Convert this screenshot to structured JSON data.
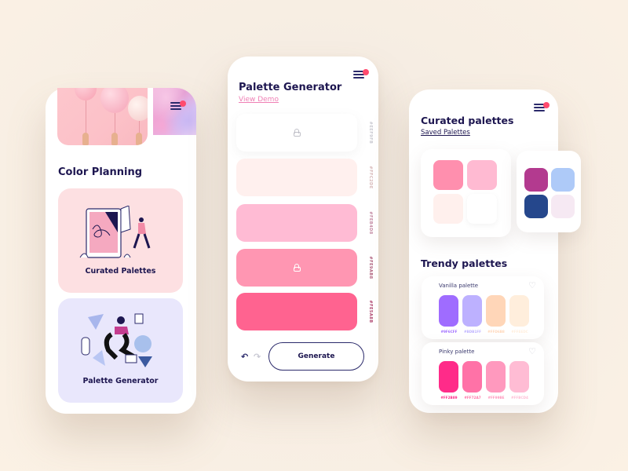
{
  "colors": {
    "navy": "#1d1650",
    "accent_dot": "#ff4b6e",
    "link_pink": "#ef7fb4"
  },
  "left_screen": {
    "title": "Color Planning",
    "hero_images": [
      "balloons-photo",
      "marble-texture"
    ],
    "cards": [
      {
        "label": "Curated Palettes",
        "illustration": "tablet-drawing-person",
        "bg": "#fde0e2"
      },
      {
        "label": "Palette Generator",
        "illustration": "floating-person-shapes",
        "bg": "#e9e7fc"
      }
    ]
  },
  "middle_screen": {
    "title": "Palette Generator",
    "link": "View Demo",
    "swatches": [
      {
        "color": "#ffffff",
        "hex": "#EEF9FB",
        "locked": true
      },
      {
        "color": "#fff0ee",
        "hex": "#FFC2DE",
        "locked": false
      },
      {
        "color": "#ffbbd4",
        "hex": "#FEB4D8",
        "locked": false
      },
      {
        "color": "#ff96b2",
        "hex": "#FE9AB8",
        "locked": true
      },
      {
        "color": "#ff6390",
        "hex": "#FE5A8B",
        "locked": false
      }
    ],
    "undo_icon": "↶",
    "redo_icon": "↷",
    "generate_label": "Generate"
  },
  "right_screen": {
    "title": "Curated palettes",
    "link": "Saved Palettes",
    "curated": [
      {
        "colors": [
          "#ff8fae",
          "#ffbad2",
          "#fff0ed",
          "#ffffff"
        ]
      },
      {
        "colors": [
          "#b33a8f",
          "#aecaf8",
          "#25478c",
          "#f6e9f3"
        ]
      }
    ],
    "trendy_title": "Trendy palettes",
    "trendy": [
      {
        "name": "Vanilla palette",
        "colors": [
          "#9f6cff",
          "#bdb1ff",
          "#ffd6b8",
          "#ffeedc"
        ],
        "hexes": [
          "#9F6CFF",
          "#BDB1FF",
          "#FFD6B8",
          "#FFEEDC"
        ],
        "favorite": false
      },
      {
        "name": "Pinky palette",
        "colors": [
          "#ff2b89",
          "#ff72a7",
          "#ff99be",
          "#ffbcd4"
        ],
        "hexes": [
          "#FF2B89",
          "#FF72A7",
          "#FF99BE",
          "#FFBCD4"
        ],
        "favorite": false
      }
    ]
  }
}
